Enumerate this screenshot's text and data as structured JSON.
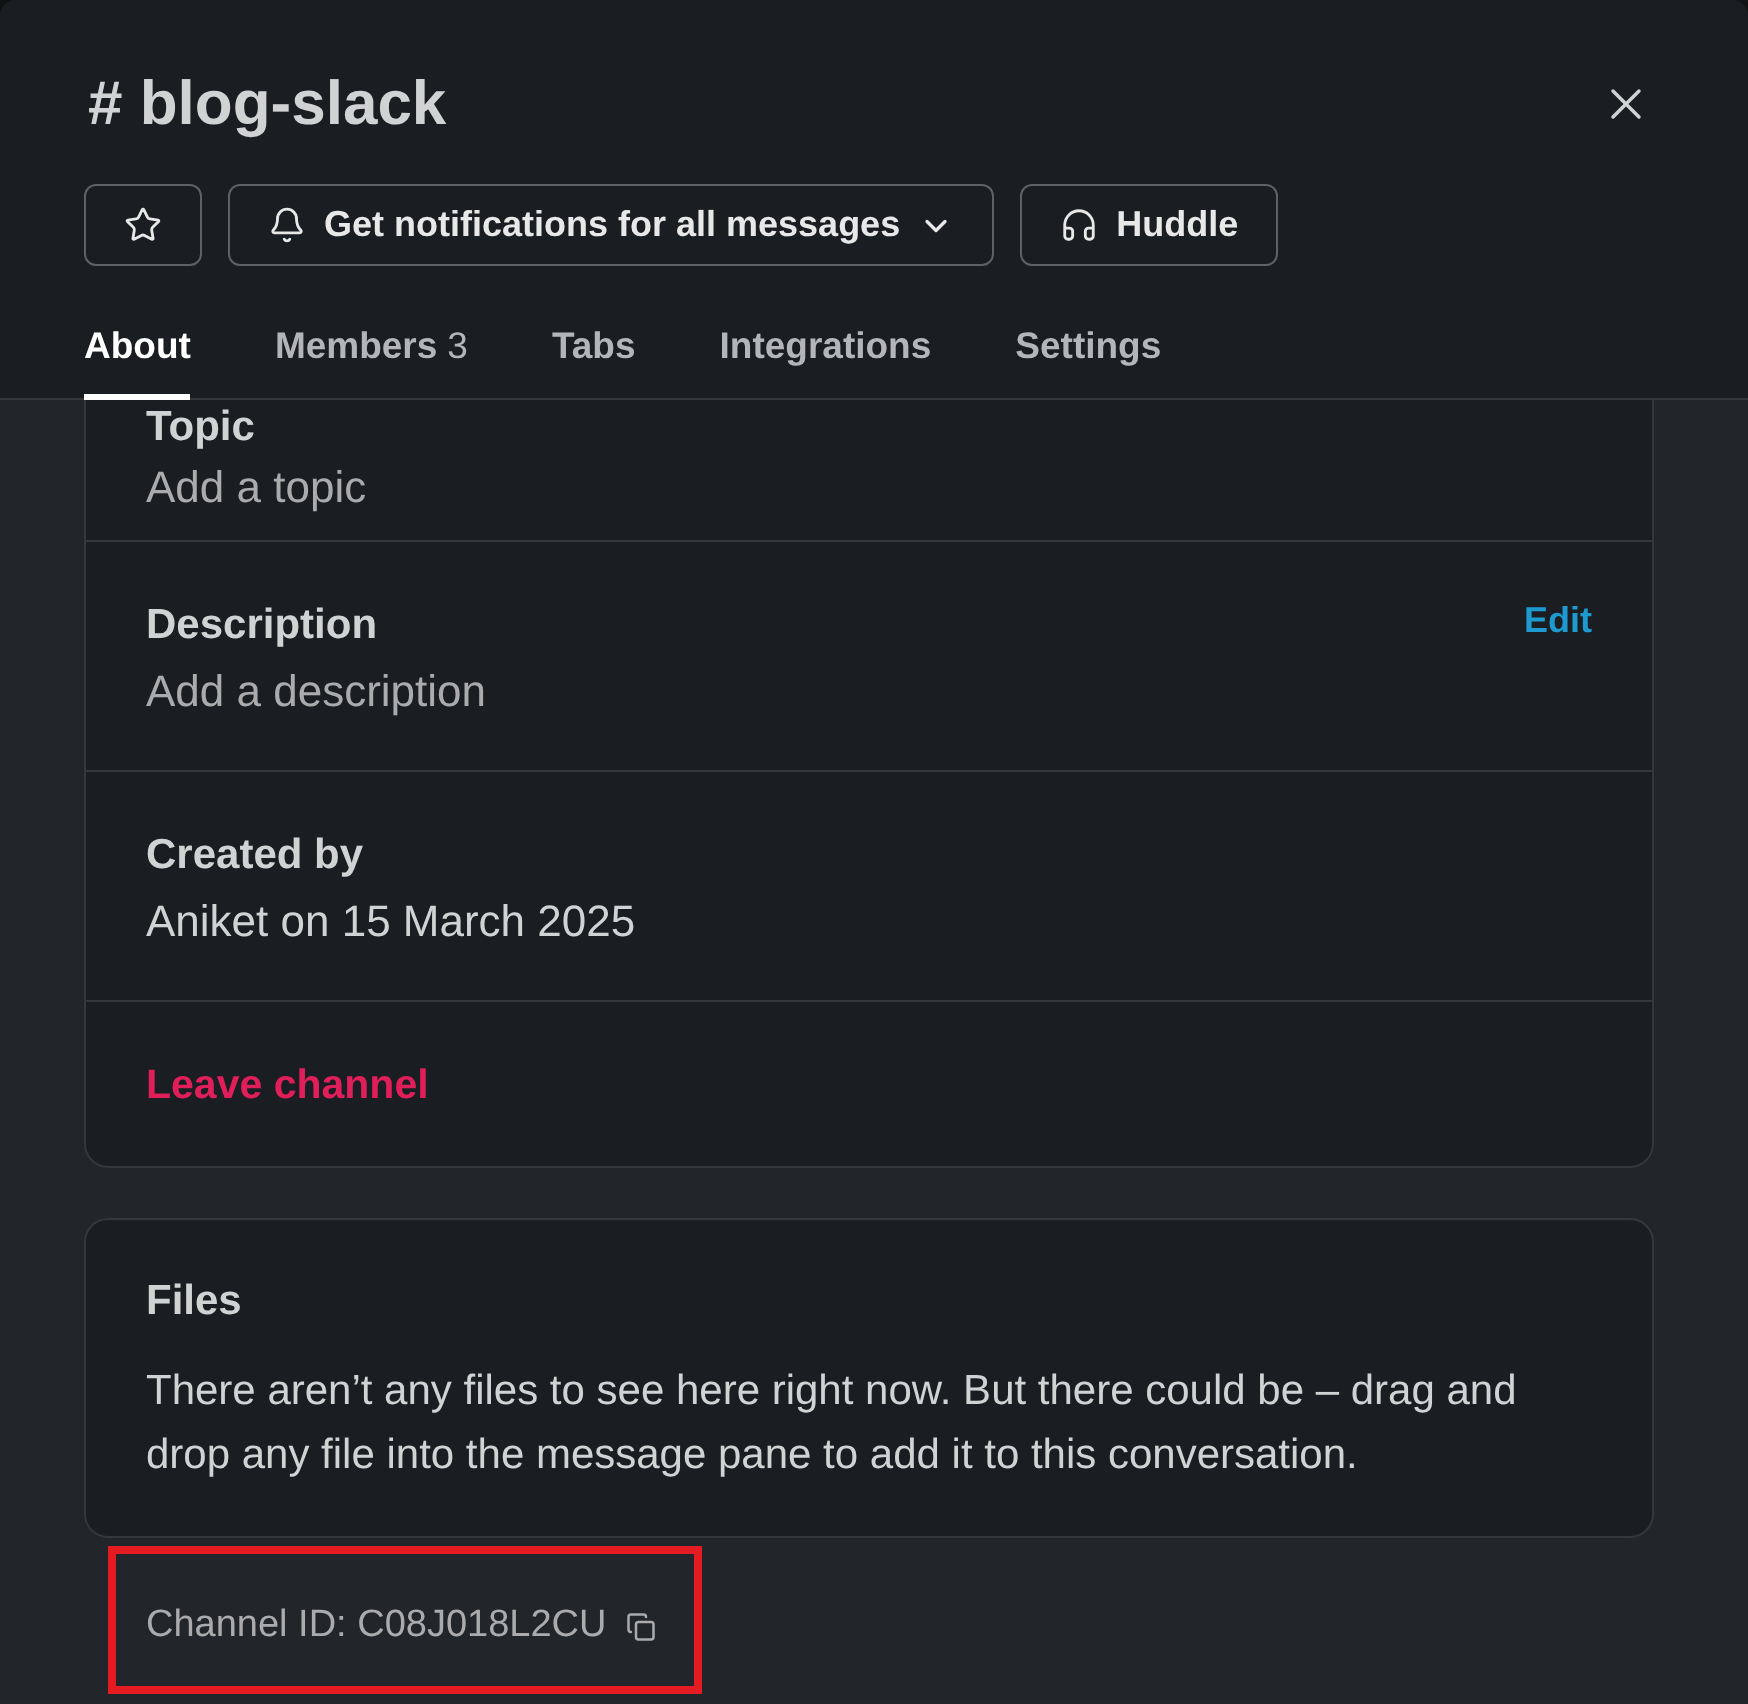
{
  "header": {
    "title": "# blog-slack"
  },
  "actions": [
    {
      "kind": "star"
    },
    {
      "kind": "notifications",
      "label": "Get notifications for all messages"
    },
    {
      "kind": "huddle",
      "label": "Huddle"
    }
  ],
  "tabs": [
    {
      "label": "About",
      "selected": true
    },
    {
      "label": "Members",
      "count": "3",
      "selected": false
    },
    {
      "label": "Tabs",
      "selected": false
    },
    {
      "label": "Integrations",
      "selected": false
    },
    {
      "label": "Settings",
      "selected": false
    }
  ],
  "about": {
    "sections": [
      {
        "label": "Topic",
        "value": "Add a topic",
        "empty": true
      },
      {
        "label": "Description",
        "value": "Add a description",
        "action": "Edit",
        "empty": true
      },
      {
        "label": "Created by",
        "value": "Aniket on 15 March 2025",
        "empty": false
      }
    ],
    "leave": "Leave channel"
  },
  "files": {
    "title": "Files",
    "text": "There aren’t any files to see here right now. But there could be – drag and drop any file into the message pane to add it to this conversation."
  },
  "channel_id": {
    "text": "Channel ID: C08J018L2CU",
    "highlighted": true
  }
}
